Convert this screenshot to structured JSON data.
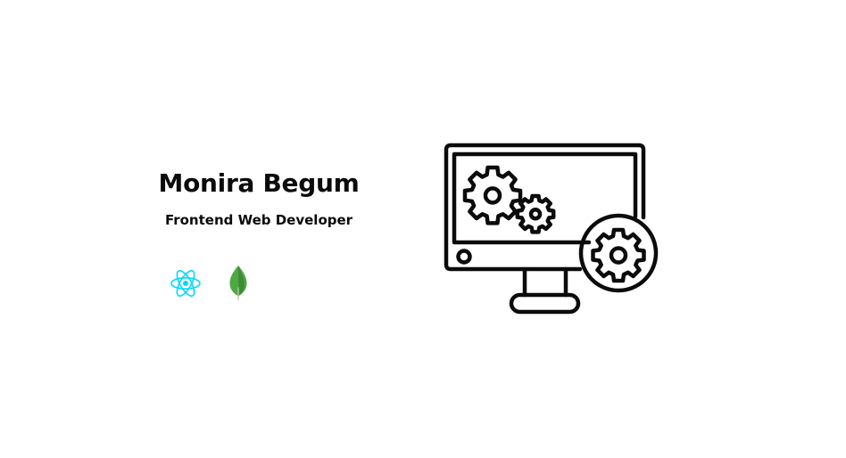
{
  "profile": {
    "name": "Monira Begum",
    "role": "Frontend Web Developer"
  },
  "tech_icons": [
    {
      "icon": "react-logo-icon",
      "color": "#00d8ff"
    },
    {
      "icon": "mongodb-leaf-icon",
      "color": "#4fa942"
    }
  ],
  "illustration": {
    "icon": "monitor-with-gears-icon",
    "color": "#0b0b0b"
  }
}
